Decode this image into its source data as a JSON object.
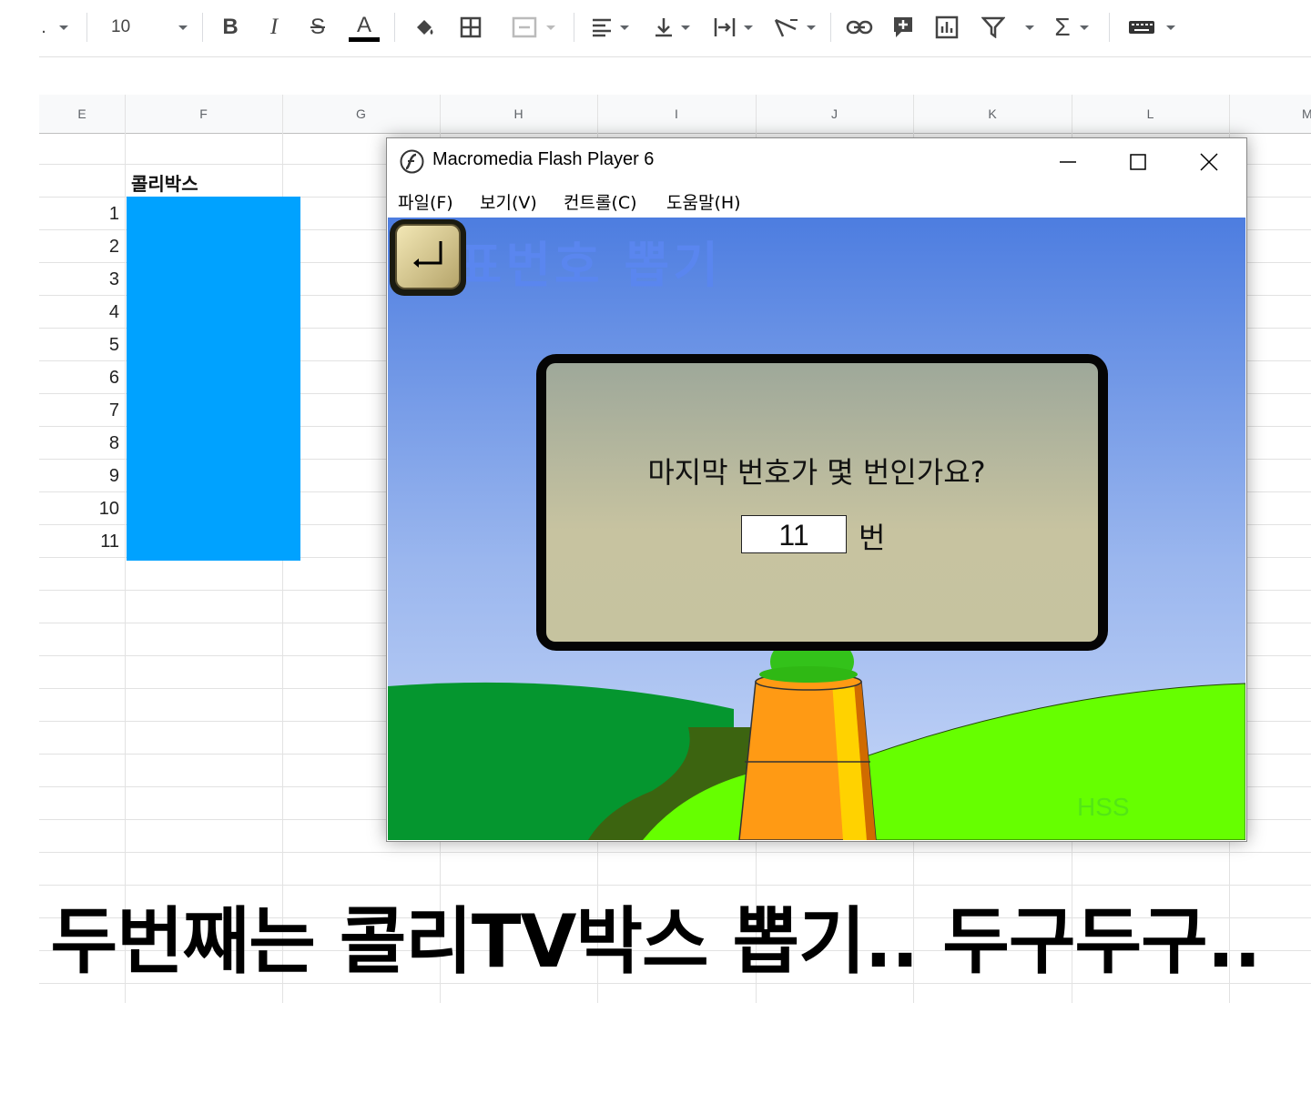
{
  "toolbar": {
    "font_size": "10",
    "dot": ".",
    "icons": [
      "dropdown-caret",
      "bold-icon",
      "italic-icon",
      "strikethrough-icon",
      "text-color-icon",
      "fill-color-icon",
      "borders-icon",
      "merge-cells-icon",
      "horizontal-align-icon",
      "vertical-align-icon",
      "text-wrap-icon",
      "text-rotation-icon",
      "link-icon",
      "insert-comment-icon",
      "insert-chart-icon",
      "filter-icon",
      "functions-icon",
      "input-tools-icon"
    ],
    "bold": "B",
    "italic": "I",
    "strike": "S",
    "textcolor": "A",
    "sigma": "Σ",
    "accent_color": "#000000"
  },
  "sheet": {
    "columns": [
      "E",
      "F",
      "G",
      "H",
      "I",
      "J",
      "K",
      "L",
      "M"
    ],
    "f_label": "콜리박스",
    "rows": [
      "1",
      "2",
      "3",
      "4",
      "5",
      "6",
      "7",
      "8",
      "9",
      "10",
      "11"
    ],
    "highlight_color": "#00a2ff"
  },
  "flash_window": {
    "title": "Macromedia Flash Player 6",
    "menu": [
      "파일(F)",
      "보기(V)",
      "컨트롤(C)",
      "도움말(H)"
    ],
    "stage_title": "발표번호 뽑기",
    "question": "마지막 번호가 몇 번인가요?",
    "input_value": "11",
    "unit": "번",
    "credit": "HSS"
  },
  "caption": "두번째는 콜리TV박스 뽑기.. 두구두구.."
}
